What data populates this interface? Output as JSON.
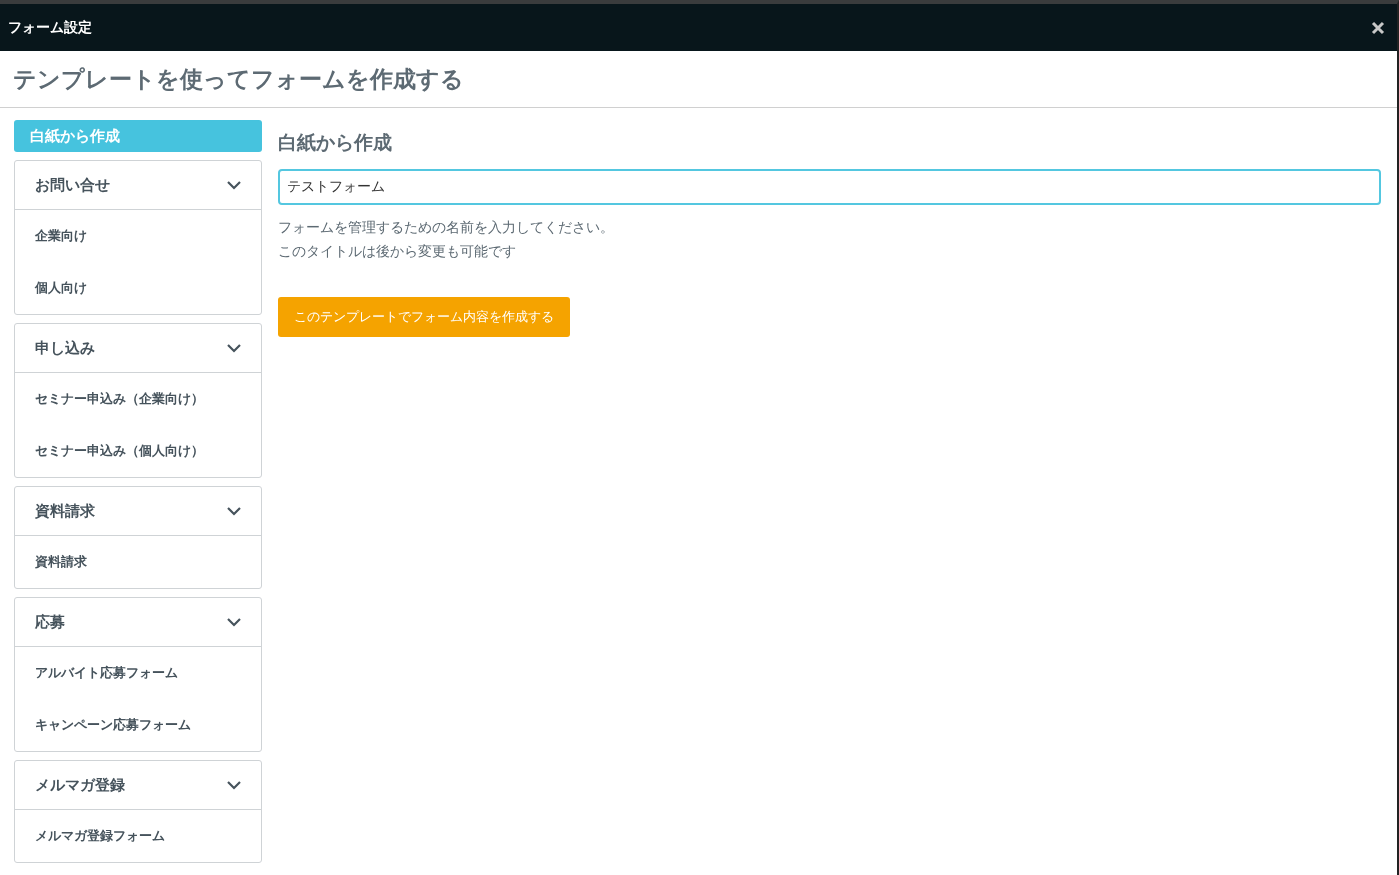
{
  "window": {
    "title": "フォーム設定"
  },
  "page_title": "テンプレートを使ってフォームを作成する",
  "sidebar": {
    "blank": {
      "label": "白紙から作成",
      "selected": true
    },
    "categories": [
      {
        "label": "お問い合せ",
        "expanded": true,
        "templates": [
          {
            "label": "企業向け"
          },
          {
            "label": "個人向け"
          }
        ]
      },
      {
        "label": "申し込み",
        "expanded": true,
        "templates": [
          {
            "label": "セミナー申込み（企業向け）"
          },
          {
            "label": "セミナー申込み（個人向け）"
          }
        ]
      },
      {
        "label": "資料請求",
        "expanded": true,
        "templates": [
          {
            "label": "資料請求"
          }
        ]
      },
      {
        "label": "応募",
        "expanded": true,
        "templates": [
          {
            "label": "アルバイト応募フォーム"
          },
          {
            "label": "キャンペーン応募フォーム"
          }
        ]
      },
      {
        "label": "メルマガ登録",
        "expanded": true,
        "templates": [
          {
            "label": "メルマガ登録フォーム"
          }
        ]
      }
    ]
  },
  "main": {
    "heading": "白紙から作成",
    "name_field": {
      "value": "テストフォーム"
    },
    "help": [
      "フォームを管理するための名前を入力してください。",
      "このタイトルは後から変更も可能です"
    ],
    "submit_button": "このテンプレートでフォーム内容を作成する"
  }
}
